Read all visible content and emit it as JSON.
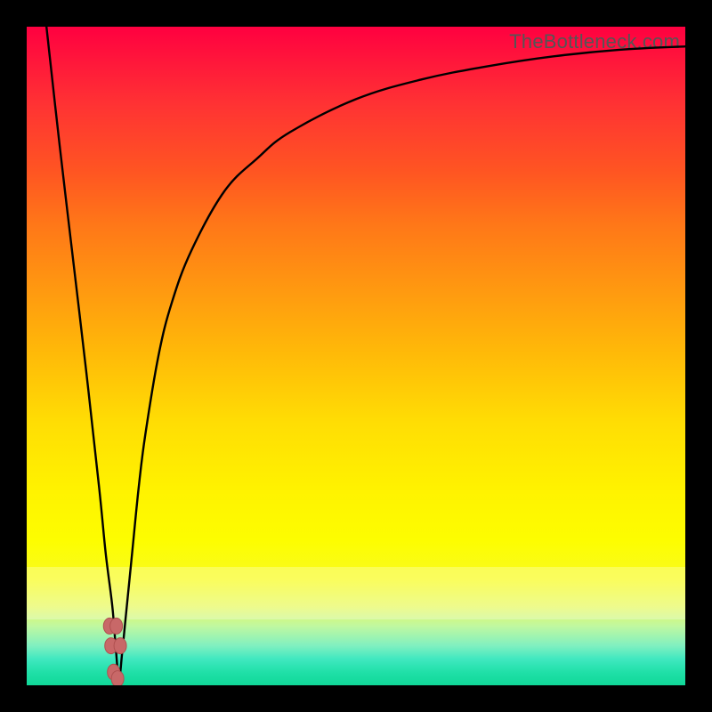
{
  "watermark": "TheBottleneck.com",
  "chart_data": {
    "type": "line",
    "title": "",
    "xlabel": "",
    "ylabel": "",
    "xlim": [
      0,
      100
    ],
    "ylim": [
      0,
      100
    ],
    "grid": false,
    "legend": false,
    "series": [
      {
        "name": "bottleneck-curve",
        "x": [
          3,
          5,
          7,
          9,
          11,
          12,
          13,
          13.5,
          14,
          14.5,
          15,
          16,
          17,
          18,
          20,
          22,
          25,
          30,
          35,
          40,
          50,
          60,
          70,
          80,
          90,
          100
        ],
        "y": [
          100,
          82,
          65,
          48,
          30,
          20,
          12,
          6,
          1,
          5,
          10,
          20,
          30,
          38,
          50,
          58,
          66,
          75,
          80,
          84,
          89,
          92,
          94,
          95.5,
          96.5,
          97
        ]
      }
    ],
    "points": {
      "name": "highlighted-points",
      "x": [
        12.6,
        12.8,
        13.6,
        14.2,
        13.2,
        13.8
      ],
      "y": [
        9,
        6,
        9,
        6,
        2,
        1
      ]
    },
    "background_gradient": {
      "top": "#ff0040",
      "mid": "#fff200",
      "bottom": "#10d898"
    }
  }
}
